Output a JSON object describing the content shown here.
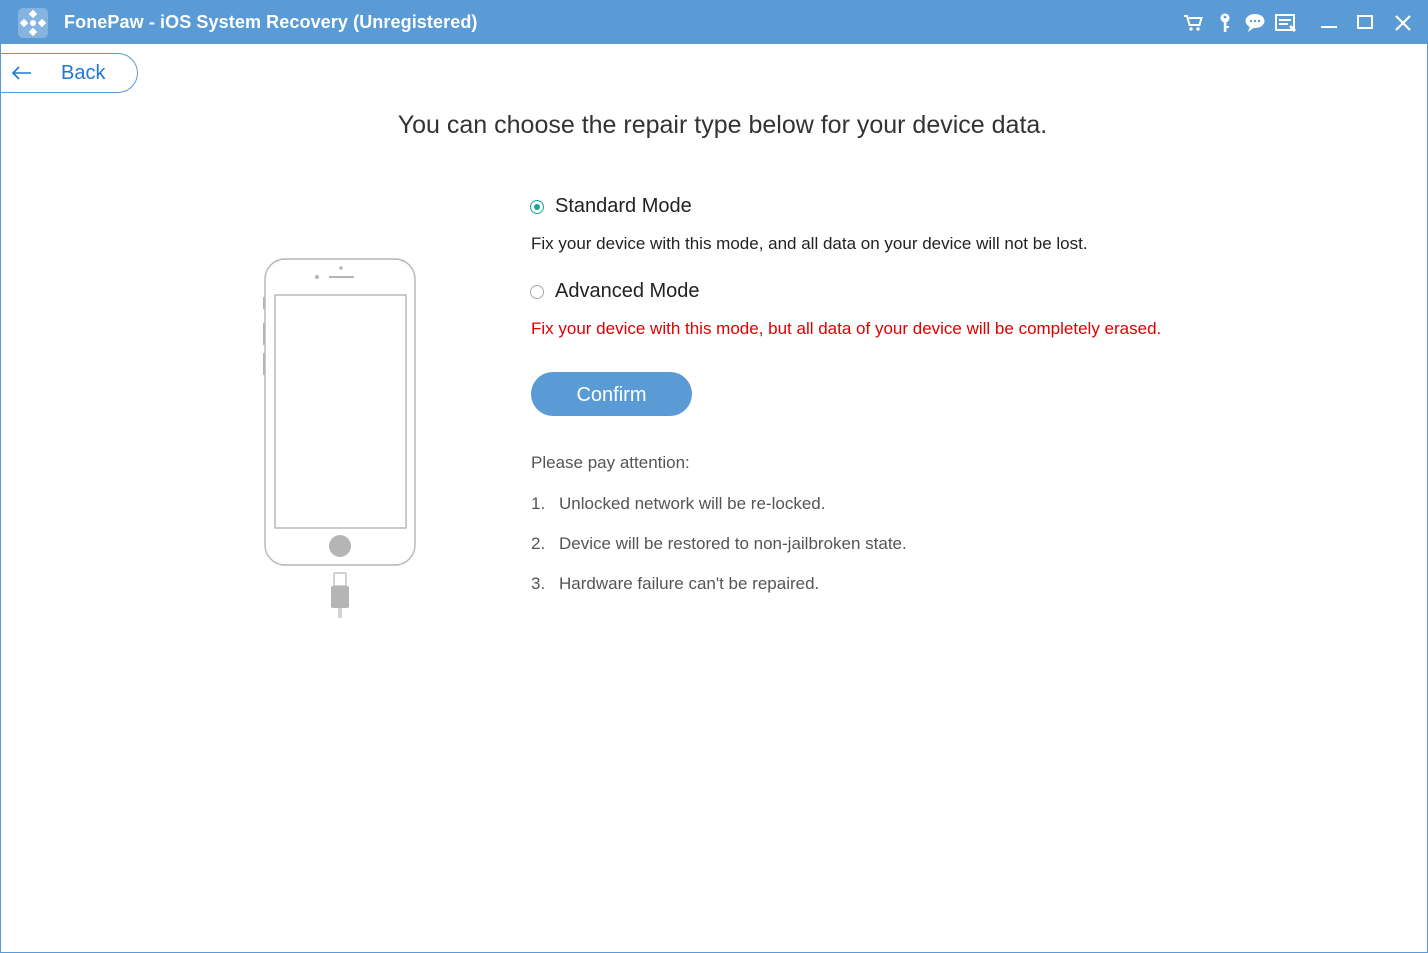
{
  "window": {
    "title": "FonePaw - iOS System Recovery (Unregistered)",
    "accent_color": "#5b9bd5",
    "toolbar_icons": [
      "cart-icon",
      "key-icon",
      "chat-icon",
      "feedback-icon",
      "minimize-icon",
      "maximize-icon",
      "close-icon"
    ]
  },
  "back": {
    "label": "Back"
  },
  "heading": "You can choose the repair type below for your device data.",
  "modes": [
    {
      "label": "Standard Mode",
      "selected": true,
      "description": "Fix your device with this mode, and all data on your device will not be lost."
    },
    {
      "label": "Advanced Mode",
      "selected": false,
      "description": "Fix your device with this mode, but all data of your device will be completely erased."
    }
  ],
  "confirm": {
    "label": "Confirm"
  },
  "attention": {
    "title": "Please pay attention:",
    "items": [
      {
        "num": "1.",
        "text": "Unlocked network will be re-locked."
      },
      {
        "num": "2.",
        "text": "Device will be restored to non-jailbroken state."
      },
      {
        "num": "3.",
        "text": "Hardware failure can't be repaired."
      }
    ]
  },
  "colors": {
    "warning": "#e00000",
    "radio_checked": "#1aa59a"
  }
}
